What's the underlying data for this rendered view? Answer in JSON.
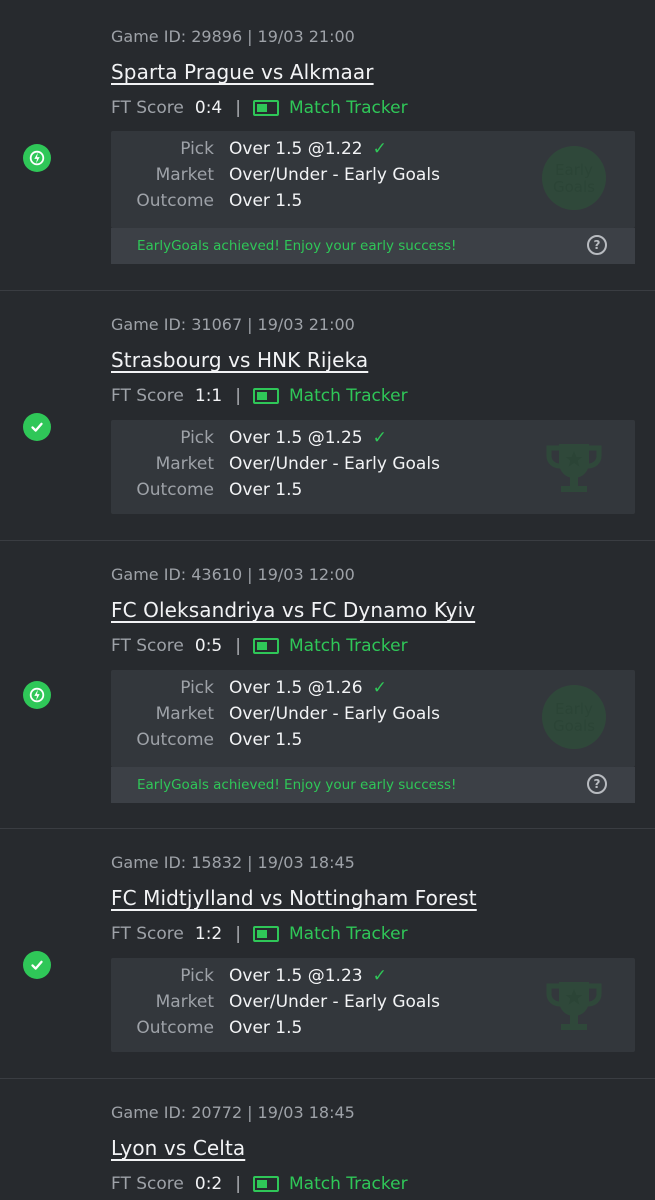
{
  "labels": {
    "game_id_prefix": "Game ID:",
    "ft_score": "FT Score",
    "match_tracker": "Match Tracker",
    "pick": "Pick",
    "market": "Market",
    "outcome": "Outcome",
    "separator": "|"
  },
  "colors": {
    "background": "#272a2e",
    "panel": "#33373c",
    "accent_green": "#2fc758",
    "muted_text": "#9ea2a8"
  },
  "games": [
    {
      "status_icon": "lightning-icon",
      "game_id": "29896",
      "datetime": "19/03 21:00",
      "match": "Sparta Prague vs Alkmaar",
      "ft_score": "0:4",
      "pick": "Over 1.5 @1.22",
      "market": "Over/Under - Early Goals",
      "outcome": "Over 1.5",
      "watermark": "Early Goals",
      "note": "EarlyGoals achieved! Enjoy your early success!"
    },
    {
      "status_icon": "check-circle-icon",
      "game_id": "31067",
      "datetime": "19/03 21:00",
      "match": "Strasbourg vs HNK Rijeka",
      "ft_score": "1:1",
      "pick": "Over 1.5 @1.25",
      "market": "Over/Under - Early Goals",
      "outcome": "Over 1.5",
      "watermark": "trophy-icon"
    },
    {
      "status_icon": "lightning-icon",
      "game_id": "43610",
      "datetime": "19/03 12:00",
      "match": "FC Oleksandriya vs FC Dynamo Kyiv",
      "ft_score": "0:5",
      "pick": "Over 1.5 @1.26",
      "market": "Over/Under - Early Goals",
      "outcome": "Over 1.5",
      "watermark": "Early Goals",
      "note": "EarlyGoals achieved! Enjoy your early success!"
    },
    {
      "status_icon": "check-circle-icon",
      "game_id": "15832",
      "datetime": "19/03 18:45",
      "match": "FC Midtjylland vs Nottingham Forest",
      "ft_score": "1:2",
      "pick": "Over 1.5 @1.23",
      "market": "Over/Under - Early Goals",
      "outcome": "Over 1.5",
      "watermark": "trophy-icon"
    },
    {
      "game_id": "20772",
      "datetime": "19/03 18:45",
      "match": "Lyon vs Celta",
      "ft_score": "0:2"
    }
  ]
}
